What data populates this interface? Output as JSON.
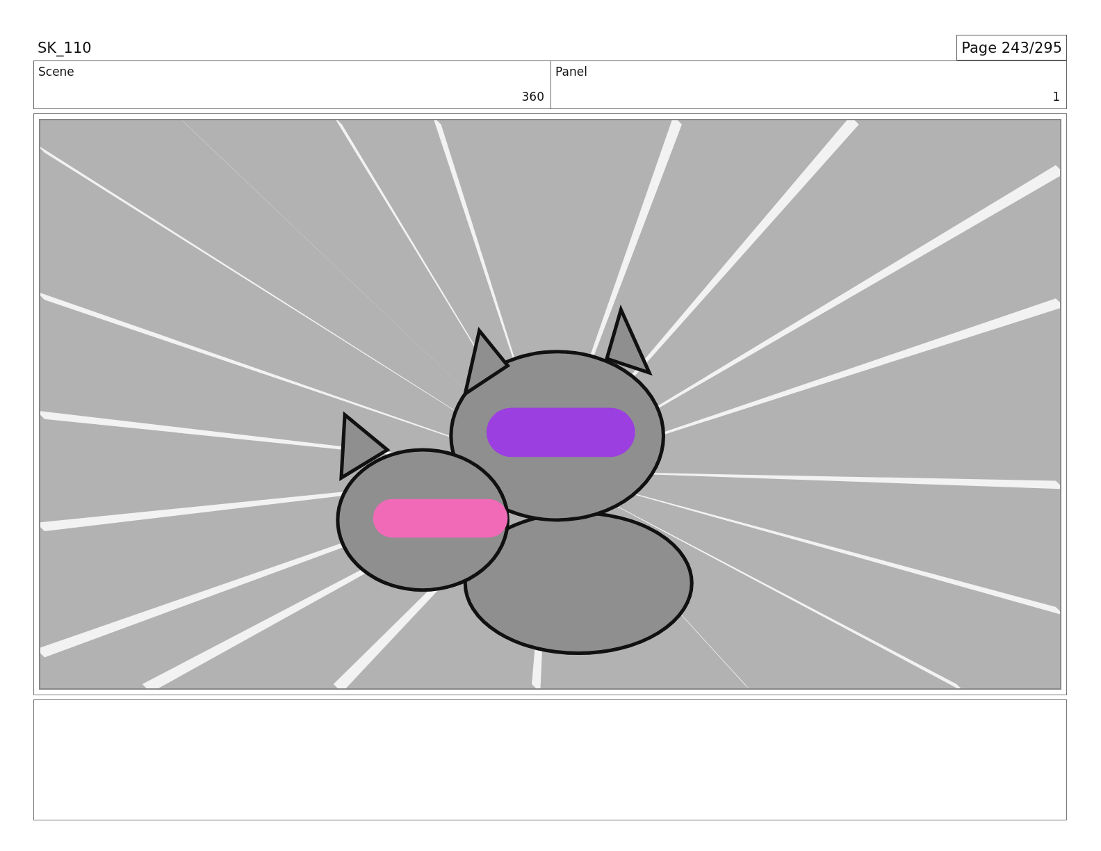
{
  "header": {
    "title": "SK_110",
    "page": "Page 243/295"
  },
  "fields": [
    {
      "label": "Scene",
      "value": "360"
    },
    {
      "label": "Panel",
      "value": "1"
    }
  ]
}
